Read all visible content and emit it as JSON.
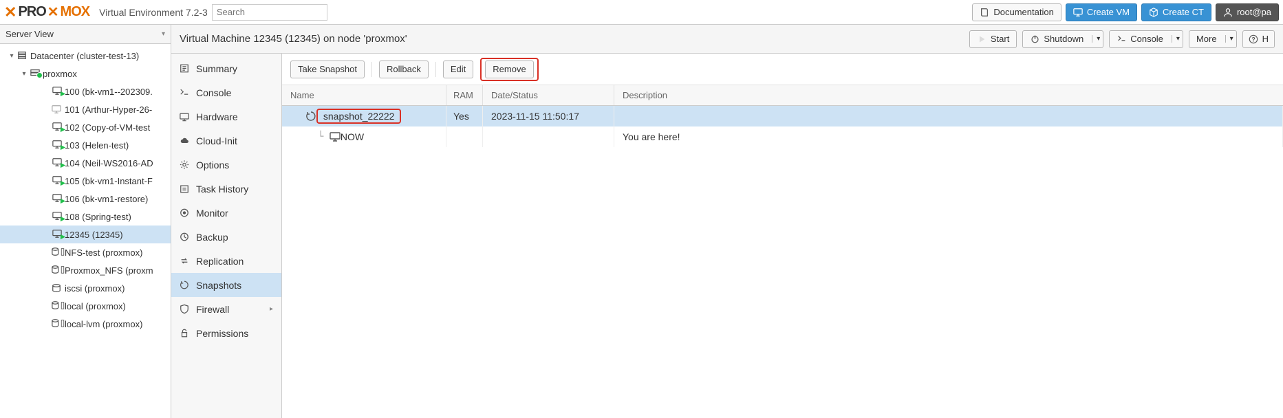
{
  "header": {
    "env_label": "Virtual Environment 7.2-3",
    "search_placeholder": "Search",
    "doc_label": "Documentation",
    "create_vm_label": "Create VM",
    "create_ct_label": "Create CT",
    "user_label": "root@pa"
  },
  "sidebar": {
    "view_label": "Server View",
    "tree": [
      {
        "indent": 10,
        "expand": "▾",
        "icon": "datacenter",
        "label": "Datacenter (cluster-test-13)"
      },
      {
        "indent": 28,
        "expand": "▾",
        "icon": "node",
        "label": "proxmox",
        "status": "green"
      },
      {
        "indent": 60,
        "expand": "",
        "icon": "vm-on",
        "label": "100 (bk-vm1--202309."
      },
      {
        "indent": 60,
        "expand": "",
        "icon": "vm-off",
        "label": "101 (Arthur-Hyper-26-"
      },
      {
        "indent": 60,
        "expand": "",
        "icon": "vm-on",
        "label": "102 (Copy-of-VM-test"
      },
      {
        "indent": 60,
        "expand": "",
        "icon": "vm-on",
        "label": "103 (Helen-test)"
      },
      {
        "indent": 60,
        "expand": "",
        "icon": "vm-on",
        "label": "104 (Neil-WS2016-AD"
      },
      {
        "indent": 60,
        "expand": "",
        "icon": "vm-on",
        "label": "105 (bk-vm1-Instant-F"
      },
      {
        "indent": 60,
        "expand": "",
        "icon": "vm-on",
        "label": "106 (bk-vm1-restore)"
      },
      {
        "indent": 60,
        "expand": "",
        "icon": "vm-on",
        "label": "108 (Spring-test)"
      },
      {
        "indent": 60,
        "expand": "",
        "icon": "vm-on",
        "label": "12345 (12345)",
        "selected": true
      },
      {
        "indent": 60,
        "expand": "",
        "icon": "storage",
        "label": "NFS-test (proxmox)"
      },
      {
        "indent": 60,
        "expand": "",
        "icon": "storage",
        "label": "Proxmox_NFS (proxm"
      },
      {
        "indent": 60,
        "expand": "",
        "icon": "storage-plain",
        "label": "iscsi (proxmox)"
      },
      {
        "indent": 60,
        "expand": "",
        "icon": "storage",
        "label": "local (proxmox)"
      },
      {
        "indent": 60,
        "expand": "",
        "icon": "storage",
        "label": "local-lvm (proxmox)"
      }
    ]
  },
  "content": {
    "title": "Virtual Machine 12345 (12345) on node 'proxmox'",
    "actions": {
      "start": "Start",
      "shutdown": "Shutdown",
      "console": "Console",
      "more": "More"
    },
    "vm_tabs": [
      {
        "icon": "summary",
        "label": "Summary"
      },
      {
        "icon": "console",
        "label": "Console"
      },
      {
        "icon": "hardware",
        "label": "Hardware"
      },
      {
        "icon": "cloud",
        "label": "Cloud-Init"
      },
      {
        "icon": "options",
        "label": "Options"
      },
      {
        "icon": "history",
        "label": "Task History"
      },
      {
        "icon": "monitor",
        "label": "Monitor"
      },
      {
        "icon": "backup",
        "label": "Backup"
      },
      {
        "icon": "replication",
        "label": "Replication"
      },
      {
        "icon": "snapshots",
        "label": "Snapshots",
        "selected": true
      },
      {
        "icon": "firewall",
        "label": "Firewall",
        "has_sub": true
      },
      {
        "icon": "permissions",
        "label": "Permissions"
      }
    ],
    "toolbar": {
      "take": "Take Snapshot",
      "rollback": "Rollback",
      "edit": "Edit",
      "remove": "Remove"
    },
    "grid": {
      "headers": {
        "name": "Name",
        "ram": "RAM",
        "date": "Date/Status",
        "desc": "Description"
      },
      "rows": [
        {
          "selected": true,
          "highlight": true,
          "indent": 22,
          "icon": "snapshot",
          "name": "snapshot_22222",
          "ram": "Yes",
          "date": "2023-11-15 11:50:17",
          "desc": ""
        },
        {
          "selected": false,
          "indent": 40,
          "connector": "└",
          "icon": "vm",
          "name": "NOW",
          "ram": "",
          "date": "",
          "desc": "You are here!"
        }
      ]
    }
  }
}
